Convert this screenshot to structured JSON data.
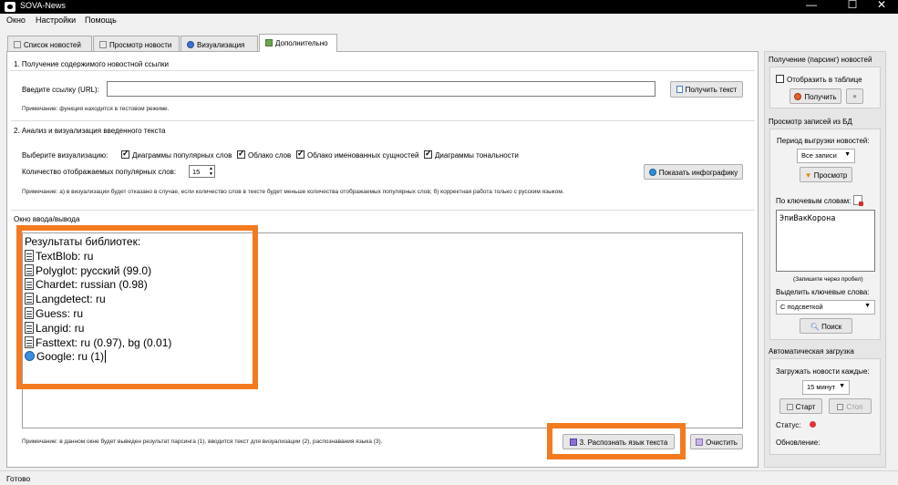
{
  "window": {
    "title": "SOVA-News",
    "minimize": "—",
    "maximize": "☐",
    "close": "✕"
  },
  "menu": [
    "Окно",
    "Настройки",
    "Помощь"
  ],
  "tabs": [
    "Список новостей",
    "Просмотр новости",
    "Визуализация",
    "Дополнительно"
  ],
  "section1": {
    "title": "1. Получение содержимого новостной ссылки",
    "url_label": "Введите ссылку (URL):",
    "url_value": "",
    "get_text_button": "Получить текст",
    "note": "Примечание: функция находится в тестовом режиме."
  },
  "section2": {
    "title": "2. Анализ и визуализация введенного текста",
    "viz_label": "Выберите визуализацию:",
    "checkboxes": [
      "Диаграммы популярных слов",
      "Облако слов",
      "Облако именованных сущностей",
      "Диаграммы тональности"
    ],
    "count_label": "Количество отображаемых популярных слов:",
    "count_value": "15",
    "show_button": "Показать  инфографику",
    "note": "Примечание: а) в визуализации будет отказано в случае, если количество слов в тексте будет меньше количества отображаемых популярных слов; б) корректная работа только с русским языком."
  },
  "io": {
    "title": "Окно ввода/вывода",
    "heading": "Результаты библиотек:",
    "lines": [
      "TextBlob: ru",
      "Polyglot:  русский (99.0)",
      "Chardet: russian (0.98)",
      "Langdetect: ru",
      "Guess: ru",
      "Langid: ru",
      "Fasttext: ru (0.97), bg (0.01)",
      "Google: ru (1)"
    ],
    "note": "Примечание: в данном окне будет выведен результат парсинга (1), вводится текст для визуализации (2), распознавания языка (3).",
    "detect_button": "3. Распознать язык текста",
    "clear_button": "Очистить"
  },
  "right": {
    "parse_title": "Получение (парсинг) новостей",
    "show_in_table": "Отобразить в таблице",
    "get_button": "Получить",
    "view_title": "Просмотр записей из БД",
    "period_label": "Период выгрузки новостей:",
    "period_value": "Все записи",
    "view_button": "Просмотр",
    "keywords_label": "По ключевым словам:",
    "keywords_value": "ЭпиВакКорона",
    "keywords_hint": "(Запишите через пробел)",
    "highlight_label": "Выделить ключевые слова:",
    "highlight_value": "С подсветкой",
    "search_button": "Поиск",
    "auto_title": "Автоматическая загрузка",
    "load_label": "Загружать новости каждые:",
    "interval_value": "15 минут",
    "start_button": "Старт",
    "stop_button": "Стоп",
    "status_label": "Статус:",
    "update_label": "Обновление:"
  },
  "statusbar": "Готово",
  "colors": {
    "accent_orange": "#f47a20",
    "status_red": "#e0343a"
  }
}
